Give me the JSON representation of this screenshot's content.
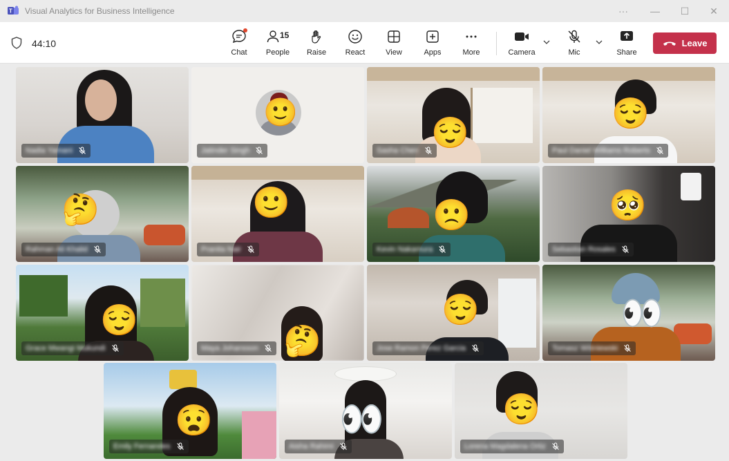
{
  "window": {
    "title": "Visual Analytics for Business Intelligence",
    "controls": [
      "···",
      "—",
      "☐",
      "✕"
    ]
  },
  "toolbar": {
    "timer": "44:10",
    "buttons": {
      "chat": "Chat",
      "people": "People",
      "people_count": "15",
      "raise": "Raise",
      "react": "React",
      "view": "View",
      "apps": "Apps",
      "more": "More",
      "camera": "Camera",
      "mic": "Mic",
      "share": "Share"
    },
    "leave": "Leave"
  },
  "participants": [
    {
      "name": "Nadia Yamani",
      "emoji": ""
    },
    {
      "name": "Jatinder Singh",
      "emoji": "🙂"
    },
    {
      "name": "Sasha Chen",
      "emoji": "😌"
    },
    {
      "name": "Paul Daniel Williams Roberts",
      "emoji": "😌"
    },
    {
      "name": "Rahman Ali Khalid",
      "emoji": "🤔"
    },
    {
      "name": "Pranita Nair",
      "emoji": "🙂"
    },
    {
      "name": "Kevin Nakamura",
      "emoji": "🙁"
    },
    {
      "name": "Sebastian Rosales",
      "emoji": "🥺"
    },
    {
      "name": "Grace Mwangi Mukundi",
      "emoji": "😌"
    },
    {
      "name": "Maya Johansson",
      "emoji": "🤔"
    },
    {
      "name": "Jose Ramon Perez Garcia",
      "emoji": "😌"
    },
    {
      "name": "Tomasz Wiśniewski",
      "emoji": "👀"
    },
    {
      "name": "Emily Fernandes",
      "emoji": "😧"
    },
    {
      "name": "Aisha Rahimi",
      "emoji": "👀"
    },
    {
      "name": "Lorena Magdalena Ortiz",
      "emoji": "😌"
    }
  ]
}
